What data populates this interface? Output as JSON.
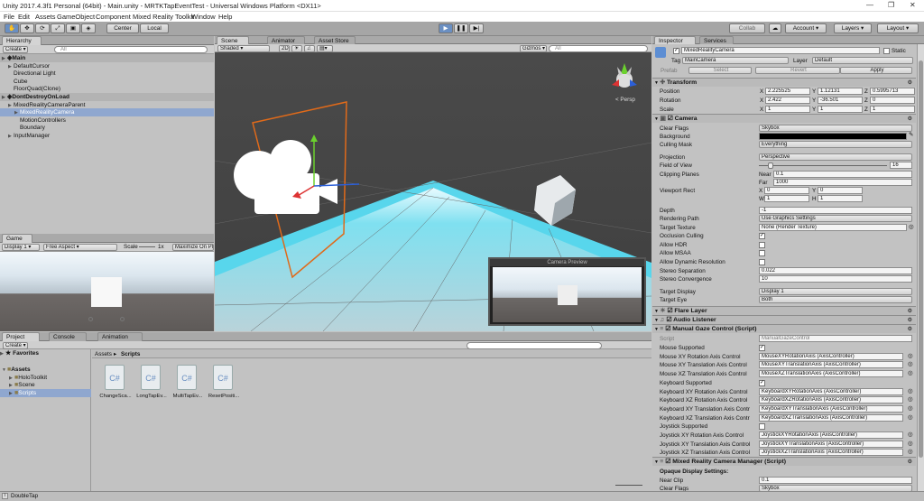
{
  "window": {
    "title": "Unity 2017.4.3f1 Personal (64bit) - Main.unity - MRTKTapEventTest - Universal Windows Platform <DX11>"
  },
  "menu": [
    "File",
    "Edit",
    "Assets",
    "GameObject",
    "Component",
    "Mixed Reality Toolkit",
    "Window",
    "Help"
  ],
  "toolbar": {
    "center": "Center",
    "local": "Local",
    "collab": "Collab",
    "account": "Account",
    "layers": "Layers",
    "layout": "Layout"
  },
  "hierarchy": {
    "tab": "Hierarchy",
    "create": "Create",
    "search": "All",
    "rows": [
      {
        "label": "Main",
        "indent": 0,
        "kind": "scene"
      },
      {
        "label": "DefaultCursor",
        "indent": 1,
        "kind": "item",
        "tri": true
      },
      {
        "label": "Directional Light",
        "indent": 1,
        "kind": "item"
      },
      {
        "label": "Cube",
        "indent": 1,
        "kind": "item"
      },
      {
        "label": "FloorQuad(Clone)",
        "indent": 1,
        "kind": "item"
      },
      {
        "label": "DontDestroyOnLoad",
        "indent": 0,
        "kind": "scene"
      },
      {
        "label": "MixedRealityCameraParent",
        "indent": 1,
        "kind": "item",
        "tri": true
      },
      {
        "label": "MixedRealityCamera",
        "indent": 2,
        "kind": "selected",
        "tri": true
      },
      {
        "label": "MotionControllers",
        "indent": 2,
        "kind": "item"
      },
      {
        "label": "Boundary",
        "indent": 2,
        "kind": "item"
      },
      {
        "label": "InputManager",
        "indent": 1,
        "kind": "item",
        "tri": true
      }
    ]
  },
  "scene": {
    "tabs": [
      "Scene",
      "Animator",
      "Asset Store"
    ],
    "shaded": "Shaded",
    "mode2d": "2D",
    "gizmos": "Gizmos",
    "search": "All",
    "persp": "< Persp",
    "preview_title": "Camera Preview"
  },
  "game": {
    "tab": "Game",
    "display": "Display 1",
    "aspect": "Free Aspect",
    "scale_label": "Scale",
    "scale": "1x",
    "maximize": "Maximize On Pl"
  },
  "project": {
    "tabs": [
      "Project",
      "Console",
      "Animation"
    ],
    "create": "Create",
    "favorites": "Favorites",
    "tree": [
      {
        "label": "Assets",
        "indent": 0,
        "bold": true
      },
      {
        "label": "HoloToolkit",
        "indent": 1
      },
      {
        "label": "Scene",
        "indent": 1
      },
      {
        "label": "Scripts",
        "indent": 1,
        "selected": true
      }
    ],
    "breadcrumb": [
      "Assets",
      "Scripts"
    ],
    "files": [
      "ChangeSca...",
      "LongTapEv...",
      "MultiTapEv...",
      "ResetPositi..."
    ]
  },
  "inspector": {
    "tabs": [
      "Inspector",
      "Services"
    ],
    "object_name": "MixedRealityCamera",
    "static": "Static",
    "tag_label": "Tag",
    "tag": "MainCamera",
    "layer_label": "Layer",
    "layer": "Default",
    "prefab": "Prefab",
    "select": "Select",
    "revert": "Revert",
    "apply": "Apply",
    "transform": {
      "title": "Transform",
      "position": {
        "label": "Position",
        "x": "2.225525",
        "y": "1.12131",
        "z": "0.5995713"
      },
      "rotation": {
        "label": "Rotation",
        "x": "2.422",
        "y": "-36.501",
        "z": "0"
      },
      "scale": {
        "label": "Scale",
        "x": "1",
        "y": "1",
        "z": "1"
      }
    },
    "camera": {
      "title": "Camera",
      "clear_flags": "Skybox",
      "culling_mask": "Everything",
      "projection": "Perspective",
      "fov": "16",
      "fov_fraction": 0.09,
      "near": "0.1",
      "far": "1000",
      "vp_x": "0",
      "vp_y": "0",
      "vp_w": "1",
      "vp_h": "1",
      "depth": "-1",
      "rendering_path": "Use Graphics Settings",
      "target_texture": "None (Render Texture)",
      "occlusion_culling": true,
      "allow_hdr": false,
      "allow_msaa": false,
      "allow_dyn_res": false,
      "stereo_sep": "0.022",
      "stereo_conv": "10",
      "target_display": "Display 1",
      "target_eye": "Both",
      "labels": [
        "Clear Flags",
        "Background",
        "Culling Mask",
        "Projection",
        "Field of View",
        "Clipping Planes",
        "Viewport Rect",
        "Depth",
        "Rendering Path",
        "Target Texture",
        "Occlusion Culling",
        "Allow HDR",
        "Allow MSAA",
        "Allow Dynamic Resolution",
        "Stereo Separation",
        "Stereo Convergence",
        "Target Display",
        "Target Eye"
      ],
      "near_label": "Near",
      "far_label": "Far",
      "x": "X",
      "y": "Y",
      "w": "W",
      "h": "H",
      "background_color": "#000000"
    },
    "flare": "Flare Layer",
    "listener": "Audio Listener",
    "gaze": {
      "title": "Manual Gaze Control (Script)",
      "script_label": "Script",
      "script": "ManualGazeControl",
      "rows": [
        {
          "label": "Mouse Supported",
          "check": true
        },
        {
          "label": "Mouse XY Rotation Axis Control",
          "value": "MouseXYRotationAxis (AxisController)"
        },
        {
          "label": "Mouse XY Translation Axis Control",
          "value": "MouseXYTranslationAxis (AxisController)"
        },
        {
          "label": "Mouse XZ Translation Axis Control",
          "value": "MouseXZTranslationAxis (AxisController)"
        },
        {
          "label": "Keyboard Supported",
          "check": true
        },
        {
          "label": "Keyboard XY Rotation Axis Control",
          "value": "KeyboardXYRotationAxis (AxisController)"
        },
        {
          "label": "Keyboard XZ Rotation Axis Control",
          "value": "KeyboardXZRotationAxis (AxisController)"
        },
        {
          "label": "Keyboard XY Translation Axis Contr",
          "value": "KeyboardXYTranslationAxis (AxisController)"
        },
        {
          "label": "Keyboard XZ Translation Axis Contr",
          "value": "KeyboardXZTranslationAxis (AxisController)"
        },
        {
          "label": "Joystick Supported",
          "check": false
        },
        {
          "label": "Joystick XY Rotation Axis Control",
          "value": "JoystickXYRotationAxis (AxisController)"
        },
        {
          "label": "Joystick XY Translation Axis Control",
          "value": "JoystickXYTranslationAxis (AxisController)"
        },
        {
          "label": "Joystick XZ Translation Axis Control",
          "value": "JoystickXZTranslationAxis (AxisController)"
        }
      ]
    },
    "manager": {
      "title": "Mixed Reality Camera Manager (Script)",
      "opaque": "Opaque Display Settings:",
      "near_clip_label": "Near Clip",
      "near_clip": "0.1",
      "clear_flags_label": "Clear Flags",
      "clear_flags": "Skybox"
    }
  },
  "status": {
    "text": "DoubleTap"
  }
}
